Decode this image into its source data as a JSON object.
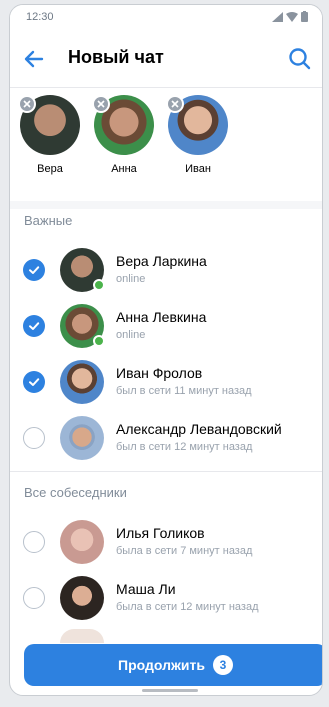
{
  "status": {
    "time": "12:30"
  },
  "header": {
    "title": "Новый чат"
  },
  "selected": [
    {
      "name": "Вера"
    },
    {
      "name": "Анна"
    },
    {
      "name": "Иван"
    }
  ],
  "sections": {
    "important": "Важные",
    "all": "Все собеседники"
  },
  "contacts": [
    {
      "name": "Вера Ларкина",
      "status": "online",
      "checked": true,
      "online": true
    },
    {
      "name": "Анна Левкина",
      "status": "online",
      "checked": true,
      "online": true
    },
    {
      "name": "Иван Фролов",
      "status": "был в сети 11 минут назад",
      "checked": true,
      "online": false
    },
    {
      "name": "Александр Левандовский",
      "status": "был в сети 12 минут назад",
      "checked": false,
      "online": false
    },
    {
      "name": "Илья Голиков",
      "status": "была в сети 7 минут назад",
      "checked": false,
      "online": false
    },
    {
      "name": "Маша Ли",
      "status": "была в сети 12 минут назад",
      "checked": false,
      "online": false
    }
  ],
  "footer": {
    "continue_label": "Продолжить",
    "count": "3"
  },
  "colors": {
    "accent": "#2d81e0",
    "online": "#4bb34b"
  },
  "icons": {
    "back": "arrow-left-icon",
    "search": "search-icon",
    "remove": "close-icon",
    "check": "checkmark-icon"
  }
}
